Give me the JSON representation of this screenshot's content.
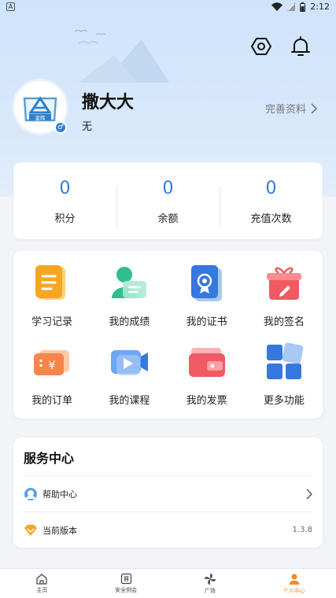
{
  "status_bar": {
    "badge": "A",
    "time": "2:12"
  },
  "profile": {
    "name": "撒大大",
    "subtitle": "无",
    "complete_link": "完善资料",
    "avatar_text": "皇晖",
    "gender_symbol": "♂"
  },
  "stats": [
    {
      "value": "0",
      "label": "积分"
    },
    {
      "value": "0",
      "label": "余额"
    },
    {
      "value": "0",
      "label": "充值次数"
    }
  ],
  "menu": [
    {
      "label": "学习记录",
      "icon": "study-record-icon"
    },
    {
      "label": "我的成绩",
      "icon": "grades-icon"
    },
    {
      "label": "我的证书",
      "icon": "certificate-icon"
    },
    {
      "label": "我的签名",
      "icon": "signature-gift-icon"
    },
    {
      "label": "我的订单",
      "icon": "order-ticket-icon"
    },
    {
      "label": "我的课程",
      "icon": "video-course-icon"
    },
    {
      "label": "我的发票",
      "icon": "invoice-wallet-icon"
    },
    {
      "label": "更多功能",
      "icon": "more-grid-icon"
    }
  ],
  "service": {
    "title": "服务中心",
    "items": [
      {
        "label": "帮助中心",
        "icon": "help-headset-icon"
      },
      {
        "label": "当前版本",
        "icon": "version-diamond-icon",
        "value": "1.3.8"
      }
    ]
  },
  "tabbar": [
    {
      "label": "主页",
      "icon": "home-icon"
    },
    {
      "label": "安全例会",
      "icon": "meeting-icon"
    },
    {
      "label": "广场",
      "icon": "pinwheel-icon"
    },
    {
      "label": "个人中心",
      "icon": "user-icon",
      "active": true
    }
  ],
  "colors": {
    "accent": "#2e7ed8",
    "tab_active": "#f08a24",
    "hero_bg": "#d3e5fb"
  }
}
